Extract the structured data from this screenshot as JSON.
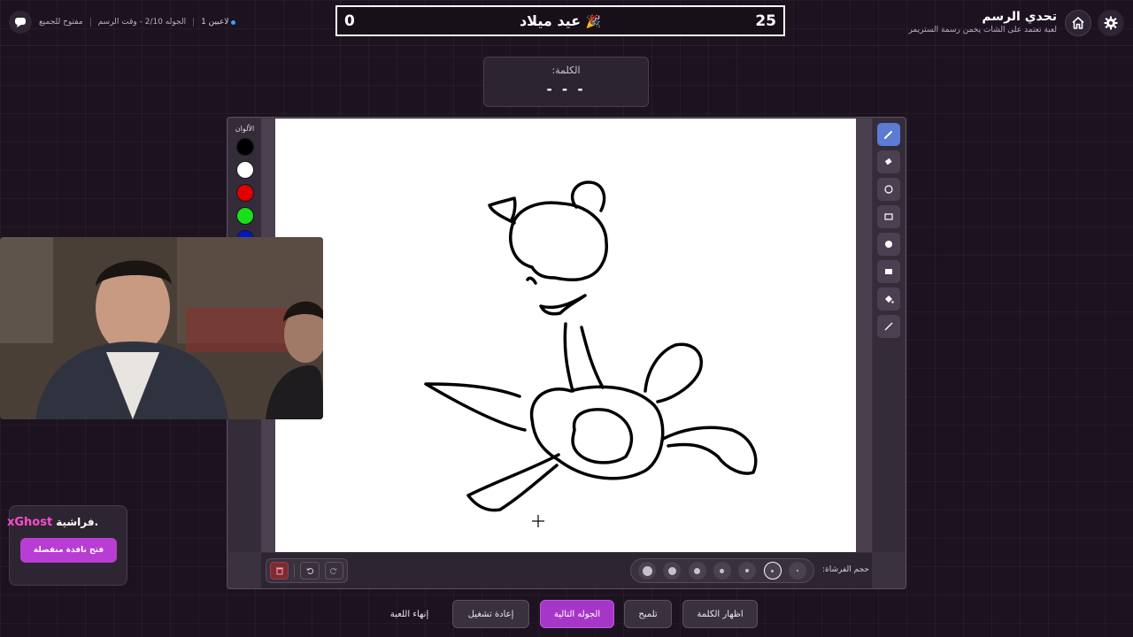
{
  "header": {
    "title": "تحدي الرسم",
    "subtitle": "لعبة تعتمد على الشات يخمن رسمة الستريمر",
    "settings_icon": "gear-icon",
    "home_icon": "home-icon"
  },
  "scoreboard": {
    "left_score": "0",
    "right_score": "25",
    "word": "عيد ميلاد",
    "emoji": "🎉"
  },
  "status": {
    "mode": "مفتوح للجميع",
    "round_info": "الجوله 2/10 - وقت الرسم",
    "players": "1 لاعبين"
  },
  "word_panel": {
    "label": "الكلمة:",
    "blanks": "- - -"
  },
  "colors": {
    "title": "الألوان",
    "swatches": [
      "#000000",
      "#ffffff",
      "#e00000",
      "#18e018",
      "#0018c8"
    ]
  },
  "brush": {
    "label": "حجم الفرشاة:"
  },
  "widget": {
    "overlay_name": "xGhost",
    "overlay_text": "فراشية.",
    "button_label": "فتح نافذة منفصلة"
  },
  "footer": {
    "show_word": "اظهار الكلمة",
    "hint": "تلميح",
    "next_round": "الجوله التالية",
    "replay": "إعادة تشغيل",
    "end_game": "إنهاء اللعبة"
  }
}
